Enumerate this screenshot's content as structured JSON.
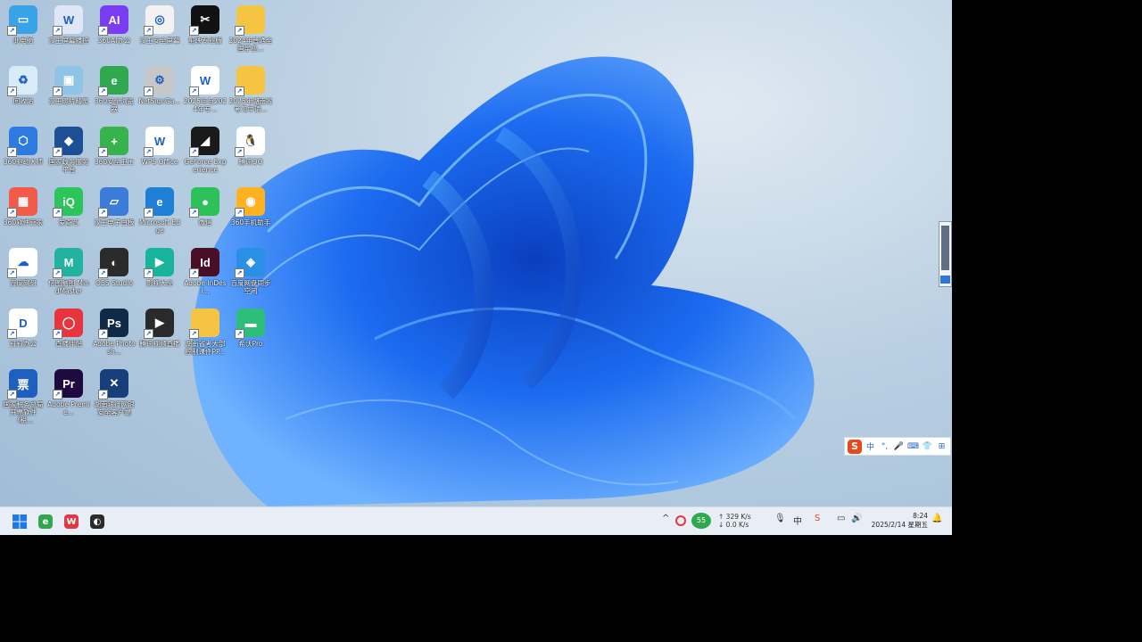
{
  "desktop_icons": [
    {
      "label": "此电脑",
      "color": "#3aa3e8",
      "glyph": "▭",
      "name": "this-pc-icon"
    },
    {
      "label": "汉王屏幕播控",
      "color": "#dfe6f5",
      "glyph": "W",
      "name": "hanwang-screen-icon"
    },
    {
      "label": "360AI办公",
      "color": "#7a3cf0",
      "glyph": "AI",
      "name": "ai-office-icon"
    },
    {
      "label": "汉王安全屏幕",
      "color": "#f2f2f2",
      "glyph": "◎",
      "name": "hanwang-security-icon"
    },
    {
      "label": "剪映专业版",
      "color": "#111111",
      "glyph": "✂",
      "name": "capcut-icon"
    },
    {
      "label": "2024年普通全国学业...",
      "color": "#f6c443",
      "glyph": "",
      "name": "folder-icon"
    },
    {
      "label": "回收站",
      "color": "#d8ecf7",
      "glyph": "♻",
      "name": "recycle-bin-icon"
    },
    {
      "label": "汉王照片精灵",
      "color": "#8fc4e6",
      "glyph": "▣",
      "name": "photo-app-icon"
    },
    {
      "label": "360安全浏览器",
      "color": "#2fa84f",
      "glyph": "e",
      "name": "360-browser-icon"
    },
    {
      "label": "NetSignGa...",
      "color": "#c7c7c7",
      "glyph": "⚙",
      "name": "netsign-icon"
    },
    {
      "label": "2025年与2024年专...",
      "color": "#ffffff",
      "glyph": "W",
      "name": "word-doc-icon"
    },
    {
      "label": "2025年湖南省考习中语...",
      "color": "#f6c443",
      "glyph": "",
      "name": "folder-icon"
    },
    {
      "label": "360驱动大师",
      "color": "#2d7be0",
      "glyph": "⬡",
      "name": "driver-master-icon"
    },
    {
      "label": "国家政务服务平台",
      "color": "#1c4f93",
      "glyph": "◆",
      "name": "gov-service-icon"
    },
    {
      "label": "360安全卫士",
      "color": "#37b24d",
      "glyph": "+",
      "name": "360-security-icon"
    },
    {
      "label": "WPS Office",
      "color": "#ffffff",
      "glyph": "W",
      "name": "wps-icon"
    },
    {
      "label": "GeForce Experience",
      "color": "#1a1a1a",
      "glyph": "◢",
      "name": "geforce-icon"
    },
    {
      "label": "腾讯QQ",
      "color": "#ffffff",
      "glyph": "🐧",
      "name": "qq-icon"
    },
    {
      "label": "360软件管家",
      "color": "#f25a4a",
      "glyph": "▦",
      "name": "software-manager-icon"
    },
    {
      "label": "爱奇艺",
      "color": "#2cc55a",
      "glyph": "iQ",
      "name": "iqiyi-icon"
    },
    {
      "label": "汉王电子白板",
      "color": "#3c7bd8",
      "glyph": "▱",
      "name": "whiteboard-icon"
    },
    {
      "label": "Microsoft Edge",
      "color": "#1d7fd6",
      "glyph": "e",
      "name": "edge-icon"
    },
    {
      "label": "微信",
      "color": "#2ec15a",
      "glyph": "●",
      "name": "wechat-icon"
    },
    {
      "label": "360手机助手",
      "color": "#ffb21f",
      "glyph": "◉",
      "name": "phone-assistant-icon"
    },
    {
      "label": "百度网盘",
      "color": "#ffffff",
      "glyph": "☁",
      "name": "baidu-netdisk-icon"
    },
    {
      "label": "亿图脑图 MindMaster",
      "color": "#22b3a0",
      "glyph": "M",
      "name": "mindmaster-icon"
    },
    {
      "label": "OBS Studio",
      "color": "#2b2b2b",
      "glyph": "◐",
      "name": "obs-icon"
    },
    {
      "label": "影视大全",
      "color": "#18b59c",
      "glyph": "▶",
      "name": "video-app-icon"
    },
    {
      "label": "Adobe InDesi...",
      "color": "#4a0f28",
      "glyph": "Id",
      "name": "indesign-icon"
    },
    {
      "label": "百度网盘同步空间",
      "color": "#2a90e6",
      "glyph": "◈",
      "name": "netdisk-sync-icon"
    },
    {
      "label": "钉钉办公",
      "color": "#ffffff",
      "glyph": "D",
      "name": "dingtalk-icon"
    },
    {
      "label": "直播伴侣",
      "color": "#e8343c",
      "glyph": "◯",
      "name": "live-companion-icon"
    },
    {
      "label": "Adobe Photosh...",
      "color": "#0e2a47",
      "glyph": "Ps",
      "name": "photoshop-icon"
    },
    {
      "label": "腾讯视频直播",
      "color": "#2a2a2a",
      "glyph": "▶",
      "name": "tencent-video-icon"
    },
    {
      "label": "湖南省考大部控制课件PP...",
      "color": "#f6c443",
      "glyph": "",
      "name": "folder-icon"
    },
    {
      "label": "希沃Pro",
      "color": "#2dbf7a",
      "glyph": "▬",
      "name": "seewo-pro-icon"
    },
    {
      "label": "国家税务总局开票软件（税...",
      "color": "#1f5fbf",
      "glyph": "票",
      "name": "tax-software-icon"
    },
    {
      "label": "Adobe Premie...",
      "color": "#1f0a40",
      "glyph": "Pr",
      "name": "premiere-icon"
    },
    {
      "label": "湖南银行网银安全客户端",
      "color": "#173f7a",
      "glyph": "✕",
      "name": "bank-client-icon"
    }
  ],
  "ime_bar": {
    "logo": "S",
    "items": [
      "中",
      "°,",
      "🎤",
      "⌨",
      "👕",
      "⊞"
    ]
  },
  "taskbar": {
    "start_icon": "windows-start-icon",
    "pinned": [
      {
        "name": "360-browser-taskbar-icon",
        "color": "#2fa84f",
        "glyph": "e"
      },
      {
        "name": "wps-taskbar-icon",
        "color": "#e8343c",
        "glyph": "W"
      },
      {
        "name": "obs-taskbar-icon",
        "color": "#2b2b2b",
        "glyph": "◐"
      }
    ],
    "tray": {
      "chevron": "^",
      "badge": "55",
      "upload": "↑ 329 K/s",
      "download": "↓ 0.0 K/s",
      "time": "8:24",
      "date": "2025/2/14 星期五"
    }
  }
}
